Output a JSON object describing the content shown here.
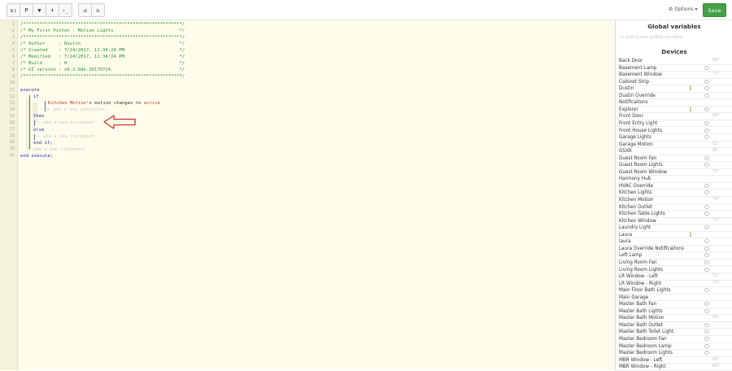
{
  "toolbar": {
    "buttons": [
      {
        "label": "x₂",
        "icon": "subscript-icon"
      },
      {
        "label": "P",
        "icon": "text-icon"
      },
      {
        "label": "▼",
        "icon": "filter-icon"
      },
      {
        "label": "⬍",
        "icon": "sort-icon"
      },
      {
        "label": "›_",
        "icon": "terminal-icon"
      },
      {
        "label": "↺",
        "icon": "undo-icon"
      },
      {
        "label": "↻",
        "icon": "redo-icon"
      }
    ],
    "options_label": "Options",
    "save_label": "Save"
  },
  "editor": {
    "line_numbers": [
      "1",
      "2",
      "3",
      "4",
      "5",
      "6",
      "7",
      "8",
      "9",
      "10",
      "11",
      "12",
      "13",
      "14",
      "15",
      "16",
      "17",
      "18",
      "19",
      "20",
      "21"
    ],
    "header_comment": [
      "/**********************************************************/",
      "/* My First Piston - Motion Lights                        */",
      "/**********************************************************/",
      "/* Author     : Dustin                                    */",
      "/* Created    : 7/24/2017, 11:34:24 PM                    */",
      "/* Modified   : 7/24/2017, 11:34:24 PM                    */",
      "/* Build      : 0                                         */",
      "/* UI version : v0.2.0de.20170724                         */",
      "/**********************************************************/"
    ],
    "kw_execute": "execute",
    "kw_if": "if",
    "condition_device": "Kitchen Motion",
    "condition_text": "'s motion changes to ",
    "condition_value": "active",
    "add_condition": "+ add a new condition",
    "kw_then": "then",
    "add_statement_then": "+ add a new statement",
    "kw_else": "else",
    "add_statement_else": "+ add a new statement",
    "kw_end_if": "end if;",
    "add_statement_outer": "+ add a new statement",
    "kw_end_execute": "end execute;"
  },
  "sidebar": {
    "global_title": "Global variables",
    "add_global": "+ add a new global variable",
    "devices_title": "Devices",
    "devices": [
      {
        "name": "Back Door",
        "icon": "",
        "value": "86°",
        "eye": false
      },
      {
        "name": "Basement Lamp",
        "icon": "",
        "value": "",
        "eye": true
      },
      {
        "name": "Basement Window",
        "icon": "",
        "value": "77°",
        "eye": false
      },
      {
        "name": "Cabinet Strip",
        "icon": "",
        "value": "",
        "eye": true
      },
      {
        "name": "Dustin",
        "icon": "🚶",
        "value": "",
        "eye": true
      },
      {
        "name": "Dustin Override",
        "icon": "",
        "value": "",
        "eye": true
      },
      {
        "name": "Notificaitons",
        "icon": "",
        "value": "",
        "eye": false
      },
      {
        "name": "Explorer",
        "icon": "🚶",
        "value": "",
        "eye": true
      },
      {
        "name": "Front Door",
        "icon": "",
        "value": "69°",
        "eye": false
      },
      {
        "name": "Front Entry Light",
        "icon": "",
        "value": "",
        "eye": true
      },
      {
        "name": "Front House Lights",
        "icon": "",
        "value": "",
        "eye": true
      },
      {
        "name": "Garage Lights",
        "icon": "",
        "value": "",
        "eye": true
      },
      {
        "name": "Garage Motion",
        "icon": "",
        "value": "91°",
        "eye": false
      },
      {
        "name": "GSXR",
        "icon": "",
        "value": "86",
        "eye": false
      },
      {
        "name": "Guest Room Fan",
        "icon": "",
        "value": "",
        "eye": true
      },
      {
        "name": "Guest Room Lights",
        "icon": "",
        "value": "",
        "eye": true
      },
      {
        "name": "Guest Room Window",
        "icon": "",
        "value": "71°",
        "eye": false
      },
      {
        "name": "Harmony Hub",
        "icon": "",
        "value": "",
        "eye": false
      },
      {
        "name": "HVAC Override",
        "icon": "",
        "value": "",
        "eye": true
      },
      {
        "name": "Kitchen Lights",
        "icon": "",
        "value": "",
        "eye": true
      },
      {
        "name": "Kitchen Motion",
        "icon": "",
        "value": "74°",
        "eye": false
      },
      {
        "name": "Kitchen Outlet",
        "icon": "",
        "value": "",
        "eye": true
      },
      {
        "name": "Kitchen Table Lights",
        "icon": "",
        "value": "",
        "eye": true
      },
      {
        "name": "Kitchen Window",
        "icon": "",
        "value": "73°",
        "eye": false
      },
      {
        "name": "Laundry Light",
        "icon": "",
        "value": "",
        "eye": true
      },
      {
        "name": "Laura",
        "icon": "🚶",
        "value": "",
        "eye": false
      },
      {
        "name": "laura",
        "icon": "",
        "value": "",
        "eye": true
      },
      {
        "name": "Laura Override Notificaitons",
        "icon": "",
        "value": "",
        "eye": true
      },
      {
        "name": "Left Lamp",
        "icon": "",
        "value": "",
        "eye": true
      },
      {
        "name": "Living Room Fan",
        "icon": "",
        "value": "",
        "eye": true
      },
      {
        "name": "Living Room Lights",
        "icon": "",
        "value": "",
        "eye": true
      },
      {
        "name": "LR Window - Left",
        "icon": "",
        "value": "72°",
        "eye": false
      },
      {
        "name": "LR Window - Right",
        "icon": "",
        "value": "70°",
        "eye": false
      },
      {
        "name": "Main Floor Bath Lights",
        "icon": "",
        "value": "",
        "eye": true
      },
      {
        "name": "Main Garage",
        "icon": "",
        "value": "",
        "eye": false
      },
      {
        "name": "Master Bath Fan",
        "icon": "",
        "value": "",
        "eye": true
      },
      {
        "name": "Master Bath Lights",
        "icon": "",
        "value": "",
        "eye": true
      },
      {
        "name": "Master Bath Motion",
        "icon": "",
        "value": "68°",
        "eye": false
      },
      {
        "name": "Master Bath Outlet",
        "icon": "",
        "value": "",
        "eye": true
      },
      {
        "name": "Master Bath Toilet Light",
        "icon": "",
        "value": "",
        "eye": true
      },
      {
        "name": "Master Bedroom Fan",
        "icon": "",
        "value": "",
        "eye": true
      },
      {
        "name": "Master Bedroom Lamp",
        "icon": "",
        "value": "",
        "eye": true
      },
      {
        "name": "Master Bedroom Lights",
        "icon": "",
        "value": "",
        "eye": true
      },
      {
        "name": "MBR Window - Left",
        "icon": "",
        "value": "69°",
        "eye": false
      },
      {
        "name": "MBR Window - Right",
        "icon": "",
        "value": "69°",
        "eye": false
      }
    ]
  }
}
